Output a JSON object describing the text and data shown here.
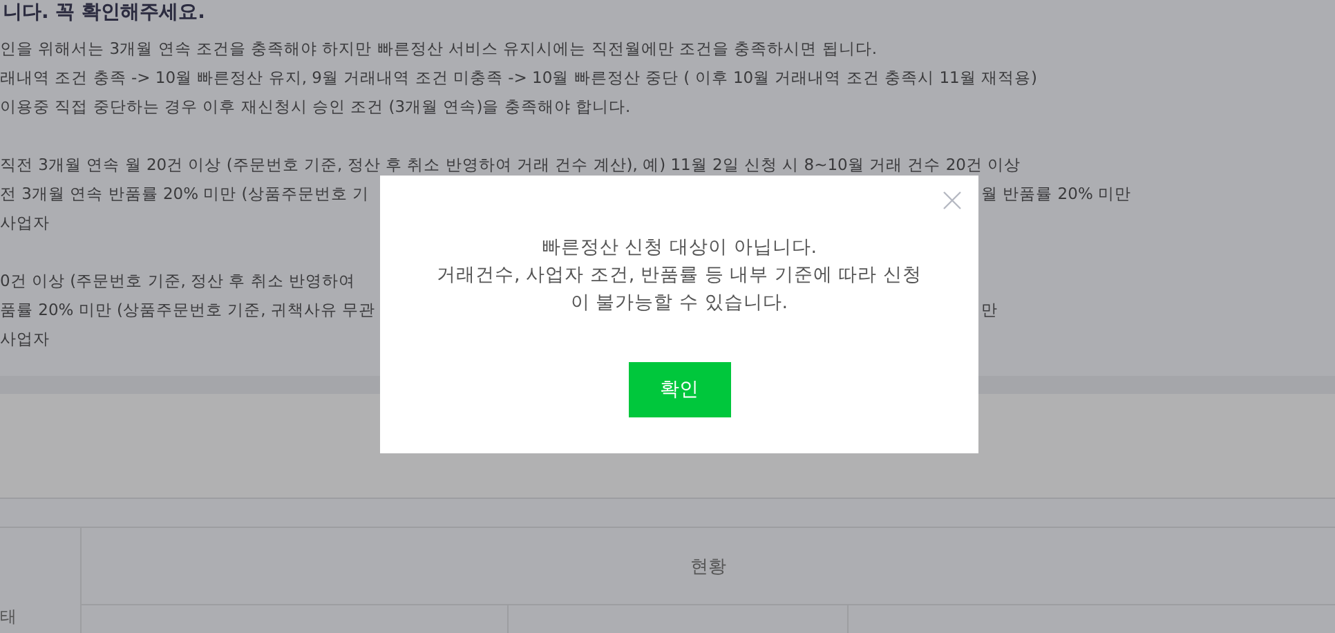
{
  "page": {
    "heading": "니다. 꼭 확인해주세요.",
    "paragraphs": [
      {
        "lines": [
          {
            "left": "인을 위해서는 3개월 연속 조건을 충족해야 하지만 빠른정산 서비스 유지시에는 직전월에만 조건을 충족하시면 됩니다."
          },
          {
            "left": "래내역 조건 충족 -> 10월 빠른정산 유지, 9월 거래내역 조건 미충족 -> 10월 빠른정산 중단 ( 이후 10월 거래내역 조건 충족시 11월 재적용)"
          },
          {
            "left": "이용중 직접 중단하는 경우 이후 재신청시 승인 조건 (3개월 연속)을 충족해야 합니다."
          }
        ]
      },
      {
        "lines": [
          {
            "left": "직전 3개월 연속 월 20건 이상 (주문번호 기준, 정산 후 취소 반영하여 거래 건수 계산), 예) 11월 2일 신청 시 8~10월 거래 건수 20건 이상"
          },
          {
            "left": "전 3개월 연속 반품률 20% 미만 (상품주문번호 기",
            "right": "월 반품률 20% 미만"
          },
          {
            "left": "사업자"
          }
        ]
      },
      {
        "lines": [
          {
            "left": "0건 이상 (주문번호 기준, 정산 후 취소 반영하여"
          },
          {
            "left": "품률 20% 미만 (상품주문번호 기준, 귀책사유 무관",
            "right": "만"
          },
          {
            "left": "사업자"
          }
        ]
      }
    ],
    "table": {
      "row_label": "태",
      "header": "현황"
    }
  },
  "dialog": {
    "message": [
      "빠른정산 신청 대상이 아닙니다.",
      "거래건수, 사업자 조건, 반품률 등 내부 기준에 따라 신청",
      "이 불가능할 수 있습니다."
    ],
    "button": "확인"
  }
}
